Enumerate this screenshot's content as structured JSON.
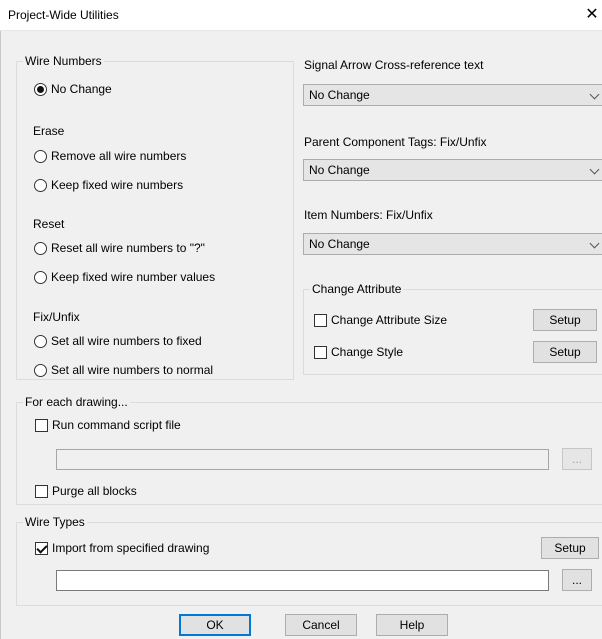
{
  "window": {
    "title": "Project-Wide Utilities",
    "close_glyph": "✕"
  },
  "wire_numbers": {
    "legend": "Wire Numbers",
    "no_change_label": "No Change",
    "erase": {
      "heading": "Erase",
      "remove_all": "Remove all wire numbers",
      "keep_fixed": "Keep fixed wire numbers"
    },
    "reset": {
      "heading": "Reset",
      "reset_all": "Reset all wire numbers to \"?\"",
      "keep_fixed_values": "Keep fixed wire number values"
    },
    "fix_unfix": {
      "heading": "Fix/Unfix",
      "set_fixed": "Set all wire numbers to fixed",
      "set_normal": "Set all wire numbers to normal"
    },
    "selected": "No Change"
  },
  "signal_arrow": {
    "label": "Signal Arrow Cross-reference text",
    "value": "No Change"
  },
  "parent_tags": {
    "label": "Parent Component Tags: Fix/Unfix",
    "value": "No Change"
  },
  "item_numbers": {
    "label": "Item Numbers: Fix/Unfix",
    "value": "No Change"
  },
  "change_attribute": {
    "legend": "Change Attribute",
    "size_label": "Change Attribute Size",
    "size_checked": false,
    "style_label": "Change Style",
    "style_checked": false,
    "setup_label": "Setup"
  },
  "for_each_drawing": {
    "legend": "For each drawing...",
    "run_script_label": "Run command script file",
    "run_script_checked": false,
    "script_path": "",
    "browse_label": "...",
    "purge_label": "Purge all blocks",
    "purge_checked": false
  },
  "wire_types": {
    "legend": "Wire Types",
    "import_label": "Import from specified drawing",
    "import_checked": true,
    "setup_label": "Setup",
    "drawing_path": "",
    "browse_label": "..."
  },
  "footer": {
    "ok_label": "OK",
    "cancel_label": "Cancel",
    "help_label": "Help"
  },
  "colors": {
    "accent": "#0078d7",
    "dialog_bg": "#f0f0f0"
  }
}
